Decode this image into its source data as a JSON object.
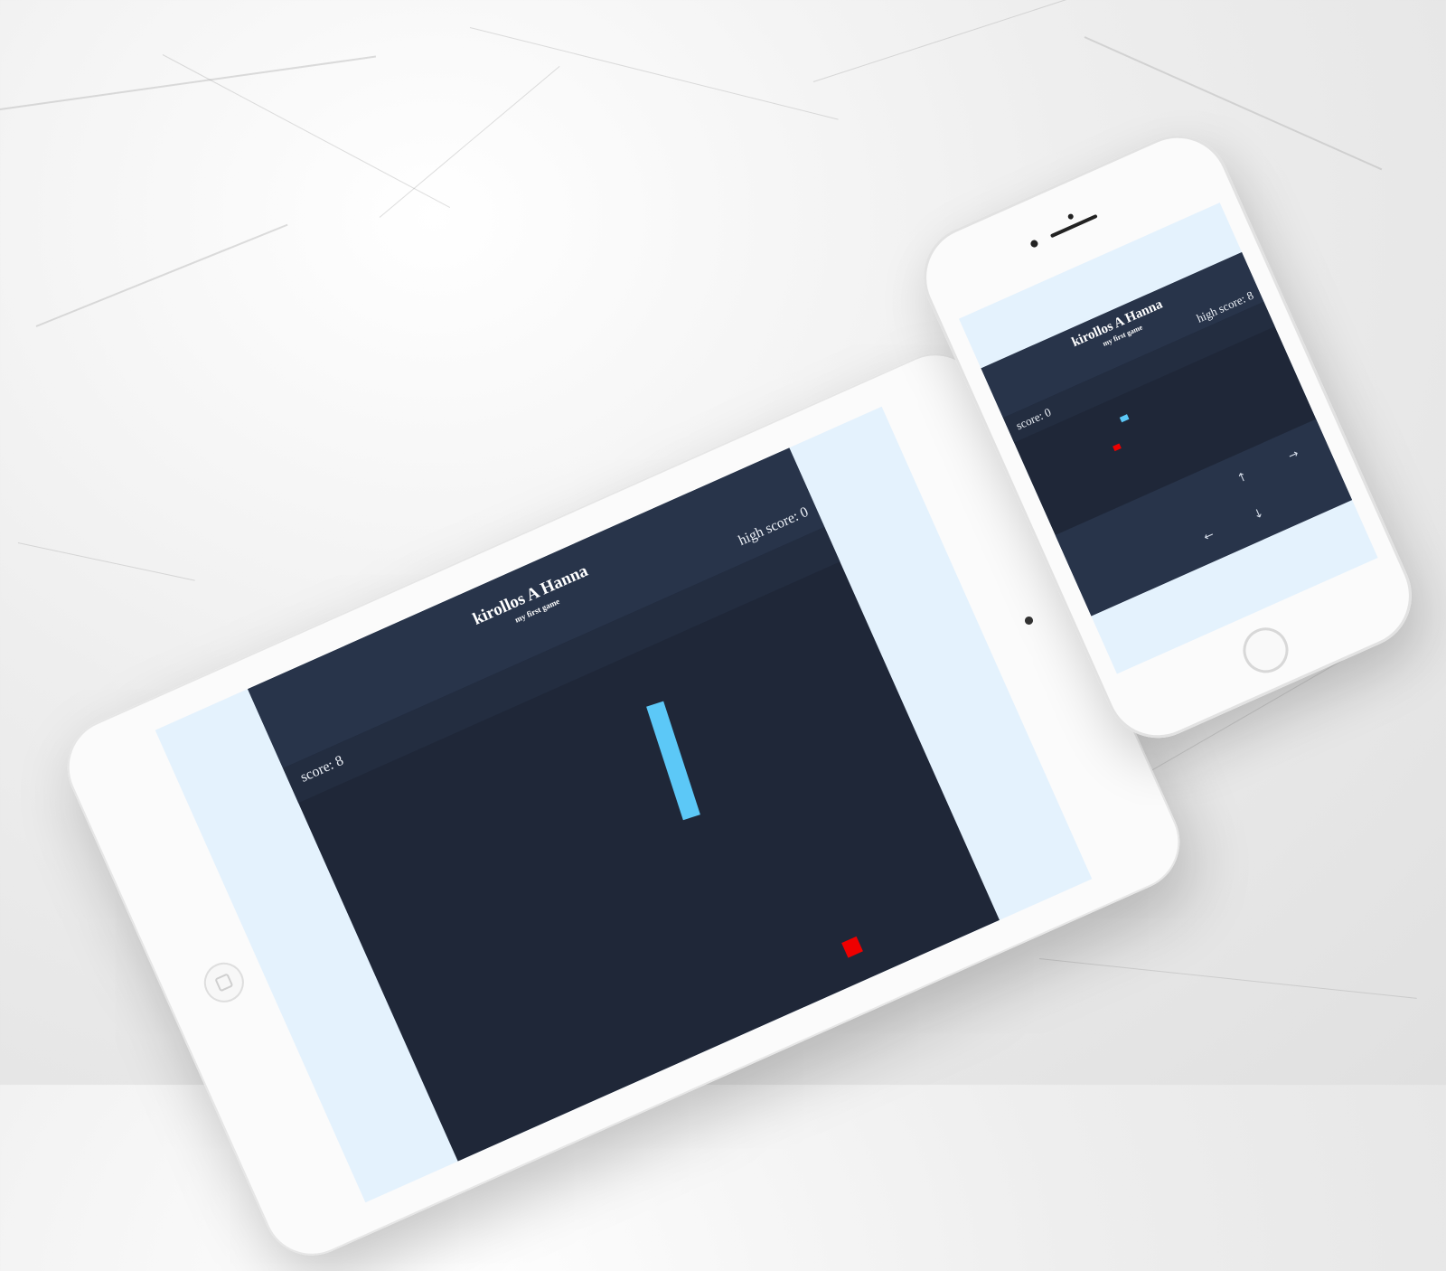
{
  "app": {
    "title": "kirollos A Hanna",
    "subtitle": "my first game"
  },
  "tablet": {
    "score_label": "score: 8",
    "high_score_label": "high score: 0",
    "snake_color": "#5cc8f7",
    "food_color": "#ee0000",
    "page_bg": "#e4f2fd",
    "header_bg": "#28344a",
    "board_bg": "#1f2738"
  },
  "phone": {
    "score_label": "score: 0",
    "high_score_label": "high score: 8",
    "snake_color": "#5cc8f7",
    "food_color": "#ee0000",
    "controls": {
      "up": "↑",
      "right": "→",
      "left": "←",
      "down": "↓"
    },
    "controls_icons": [
      "arrow-up-icon",
      "arrow-right-icon",
      "arrow-left-icon",
      "arrow-down-icon"
    ]
  }
}
